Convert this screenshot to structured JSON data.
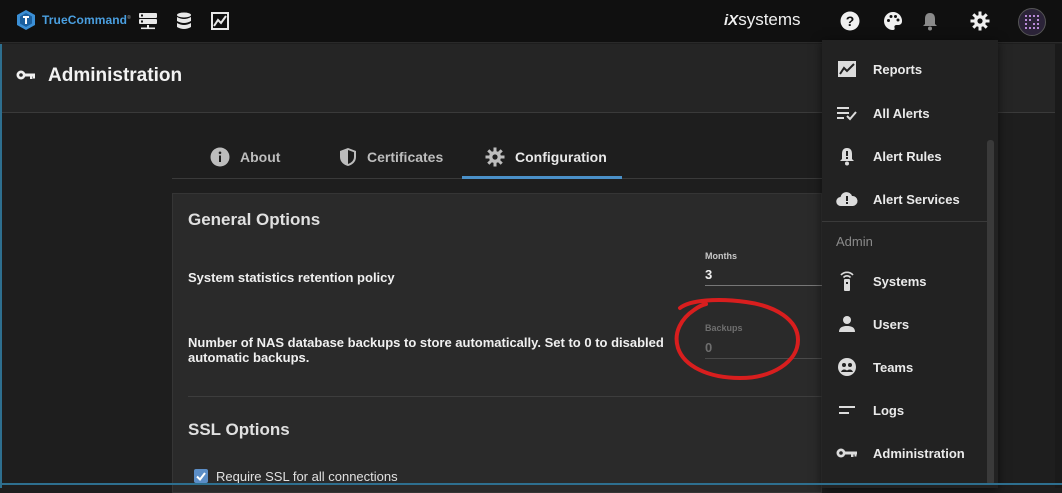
{
  "topbar": {
    "brand": "TrueCommand",
    "brand_mark": "®",
    "vendor_ix": "iX",
    "vendor_rest": "systems",
    "icons": [
      "servers-icon",
      "database-icon",
      "reports-icon",
      "help-icon",
      "palette-icon",
      "bell-icon",
      "settings-icon"
    ]
  },
  "page": {
    "title": "Administration"
  },
  "tabs": [
    {
      "label": "About",
      "icon": "info-icon"
    },
    {
      "label": "Certificates",
      "icon": "shield-icon"
    },
    {
      "label": "Configuration",
      "icon": "gear-icon",
      "active": true
    }
  ],
  "general": {
    "title": "General Options",
    "retention_label": "System statistics retention policy",
    "months_label": "Months",
    "months_value": "3",
    "backups_label_1": "Number of NAS database backups to store automatically. Set to 0 to disabled",
    "backups_label_2": "automatic backups.",
    "backups_field_label": "Backups",
    "backups_value": "0"
  },
  "ssl": {
    "title": "SSL Options",
    "require_label": "Require SSL for all connections",
    "require_checked": true
  },
  "menu": {
    "items_top": [
      {
        "label": "Reports",
        "icon": "reports-icon"
      },
      {
        "label": "All Alerts",
        "icon": "list-check-icon"
      },
      {
        "label": "Alert Rules",
        "icon": "alert-rules-icon"
      },
      {
        "label": "Alert Services",
        "icon": "cloud-alert-icon"
      }
    ],
    "admin_header": "Admin",
    "items_admin": [
      {
        "label": "Systems",
        "icon": "systems-icon"
      },
      {
        "label": "Users",
        "icon": "user-icon"
      },
      {
        "label": "Teams",
        "icon": "teams-icon"
      },
      {
        "label": "Logs",
        "icon": "logs-icon"
      },
      {
        "label": "Administration",
        "icon": "key-icon"
      }
    ]
  },
  "colors": {
    "accent": "#4a90c8",
    "annotation": "#d81e1e",
    "checkbox": "#5b8dc6"
  }
}
